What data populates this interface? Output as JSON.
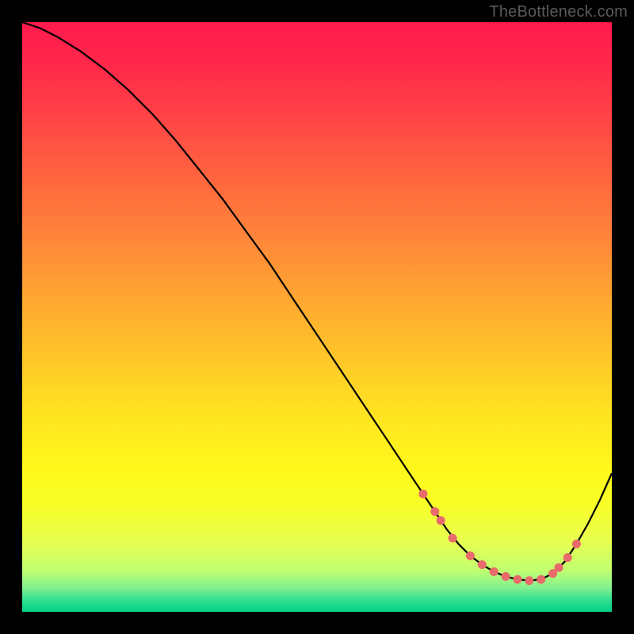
{
  "watermark": {
    "text": "TheBottleneck.com"
  },
  "colors": {
    "line": "#000000",
    "marker": "#e86a6a",
    "background_black": "#000000"
  },
  "chart_data": {
    "type": "line",
    "title": "",
    "xlabel": "",
    "ylabel": "",
    "xlim": [
      0,
      100
    ],
    "ylim": [
      0,
      100
    ],
    "grid": false,
    "legend": false,
    "series": [
      {
        "name": "bottleneck-curve",
        "x": [
          0,
          3,
          6,
          10,
          14,
          18,
          22,
          26,
          30,
          34,
          38,
          42,
          46,
          50,
          54,
          58,
          62,
          66,
          68,
          70,
          72,
          74,
          76,
          78,
          80,
          82,
          84,
          86,
          88,
          90,
          92,
          94,
          96,
          98,
          100
        ],
        "y": [
          100,
          99,
          97.5,
          95,
          92,
          88.5,
          84.5,
          80,
          75,
          70,
          64.5,
          59,
          53,
          47,
          41,
          35,
          29,
          23,
          20,
          17,
          14,
          11.5,
          9.5,
          8,
          6.8,
          6,
          5.5,
          5.3,
          5.5,
          6.5,
          8.5,
          11.5,
          15,
          19,
          23.5
        ]
      }
    ],
    "markers": {
      "name": "highlight-dots",
      "color": "#e86a6a",
      "points": [
        {
          "x": 68,
          "y": 20
        },
        {
          "x": 70,
          "y": 17
        },
        {
          "x": 71,
          "y": 15.5
        },
        {
          "x": 73,
          "y": 12.5
        },
        {
          "x": 76,
          "y": 9.5
        },
        {
          "x": 78,
          "y": 8
        },
        {
          "x": 80,
          "y": 6.8
        },
        {
          "x": 82,
          "y": 6
        },
        {
          "x": 84,
          "y": 5.5
        },
        {
          "x": 86,
          "y": 5.3
        },
        {
          "x": 88,
          "y": 5.5
        },
        {
          "x": 90,
          "y": 6.5
        },
        {
          "x": 91,
          "y": 7.5
        },
        {
          "x": 92.5,
          "y": 9.2
        },
        {
          "x": 94,
          "y": 11.5
        }
      ]
    }
  }
}
